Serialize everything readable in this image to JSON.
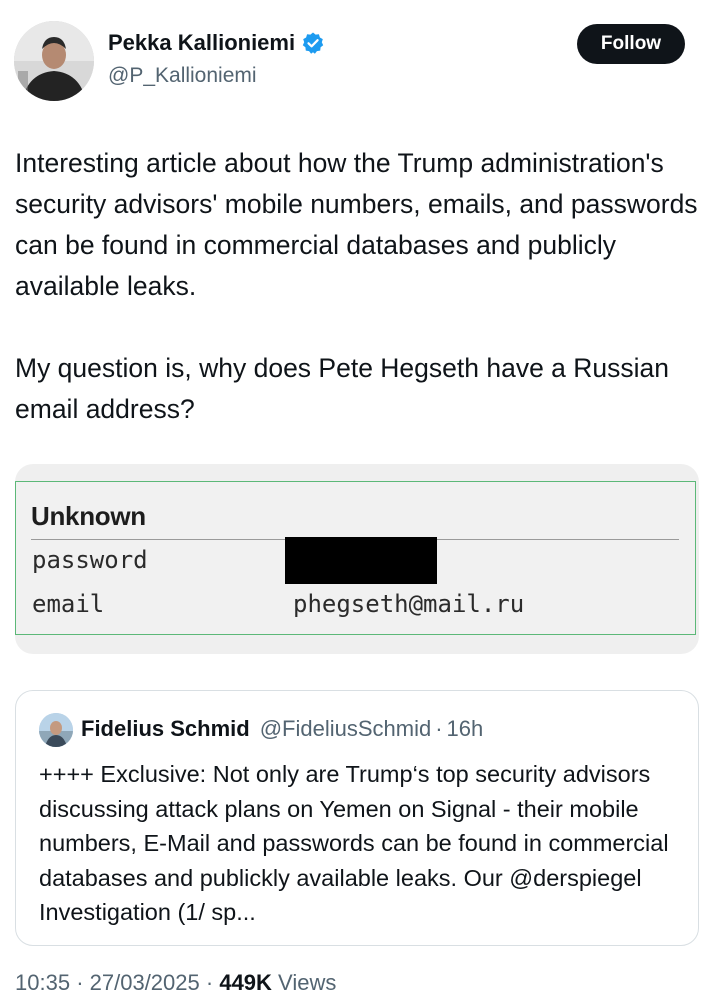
{
  "author": {
    "name": "Pekka Kallioniemi",
    "handle": "@P_Kallioniemi",
    "verified_icon": "verified-badge-icon",
    "avatar_icon": "avatar"
  },
  "follow_button": {
    "label": "Follow"
  },
  "tweet": {
    "text": "Interesting article about how the Trump administration's security advisors' mobile numbers, emails, and passwords can be found in commercial databases and publicly available leaks.\n\nMy question is, why does Pete Hegseth have a Russian email address?"
  },
  "media": {
    "heading": "Unknown",
    "rows": [
      {
        "label": "password",
        "value": ""
      },
      {
        "label": "email",
        "value": "phegseth@mail.ru"
      }
    ]
  },
  "quoted_tweet": {
    "name": "Fidelius Schmid",
    "handle": "@FideliusSchmid",
    "separator": "·",
    "time": "16h",
    "text": "++++ Exclusive: Not only are Trump‘s top security advisors discussing attack plans on Yemen on Signal - their mobile numbers, E-Mail and passwords can be found in commercial databases and publickly available leaks. Our @derspiegel Investigation (1/ sp..."
  },
  "meta": {
    "time": "10:35",
    "separator": "·",
    "date": "27/03/2025",
    "views_count": "449K",
    "views_label": "Views"
  },
  "colors": {
    "text": "#0f1419",
    "secondary": "#536471",
    "verified": "#1d9bf0",
    "follow_bg": "#0f1419",
    "media_border": "#5cb878"
  }
}
